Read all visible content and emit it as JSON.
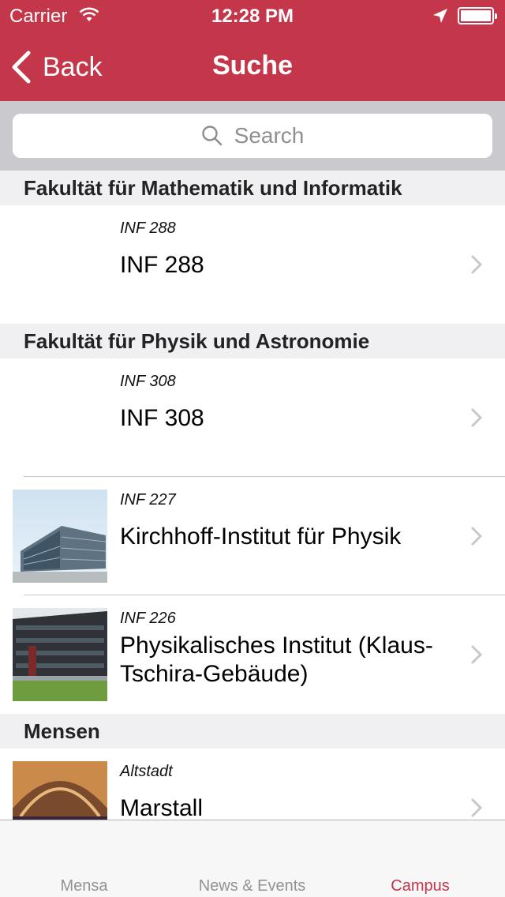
{
  "status_bar": {
    "carrier": "Carrier",
    "time": "12:28 PM"
  },
  "nav": {
    "back_label": "Back",
    "title": "Suche"
  },
  "search": {
    "placeholder": "Search"
  },
  "sections": [
    {
      "header": "Fakultät für Mathematik und Informatik",
      "rows": [
        {
          "subtitle": "INF 288",
          "title": "INF 288",
          "image": null
        }
      ]
    },
    {
      "header": "Fakultät für Physik und Astronomie",
      "rows": [
        {
          "subtitle": "INF 308",
          "title": "INF 308",
          "image": null
        },
        {
          "subtitle": "INF 227",
          "title": "Kirchhoff-Institut für Physik",
          "image": "building-glass-photo"
        },
        {
          "subtitle": "INF 226",
          "title": "Physikalisches Institut (Klaus-Tschira-Gebäude)",
          "image": "building-dark-photo"
        }
      ]
    },
    {
      "header": "Mensen",
      "rows": [
        {
          "subtitle": "Altstadt",
          "title": "Marstall",
          "image": "mensa-hall-photo"
        }
      ]
    }
  ],
  "tabs": [
    {
      "label": "Mensa",
      "active": false
    },
    {
      "label": "News & Events",
      "active": false
    },
    {
      "label": "Campus",
      "active": true
    }
  ],
  "colors": {
    "accent": "#c4364a",
    "section_bg": "#f0f0f2",
    "search_bg": "#c9c9ce"
  }
}
